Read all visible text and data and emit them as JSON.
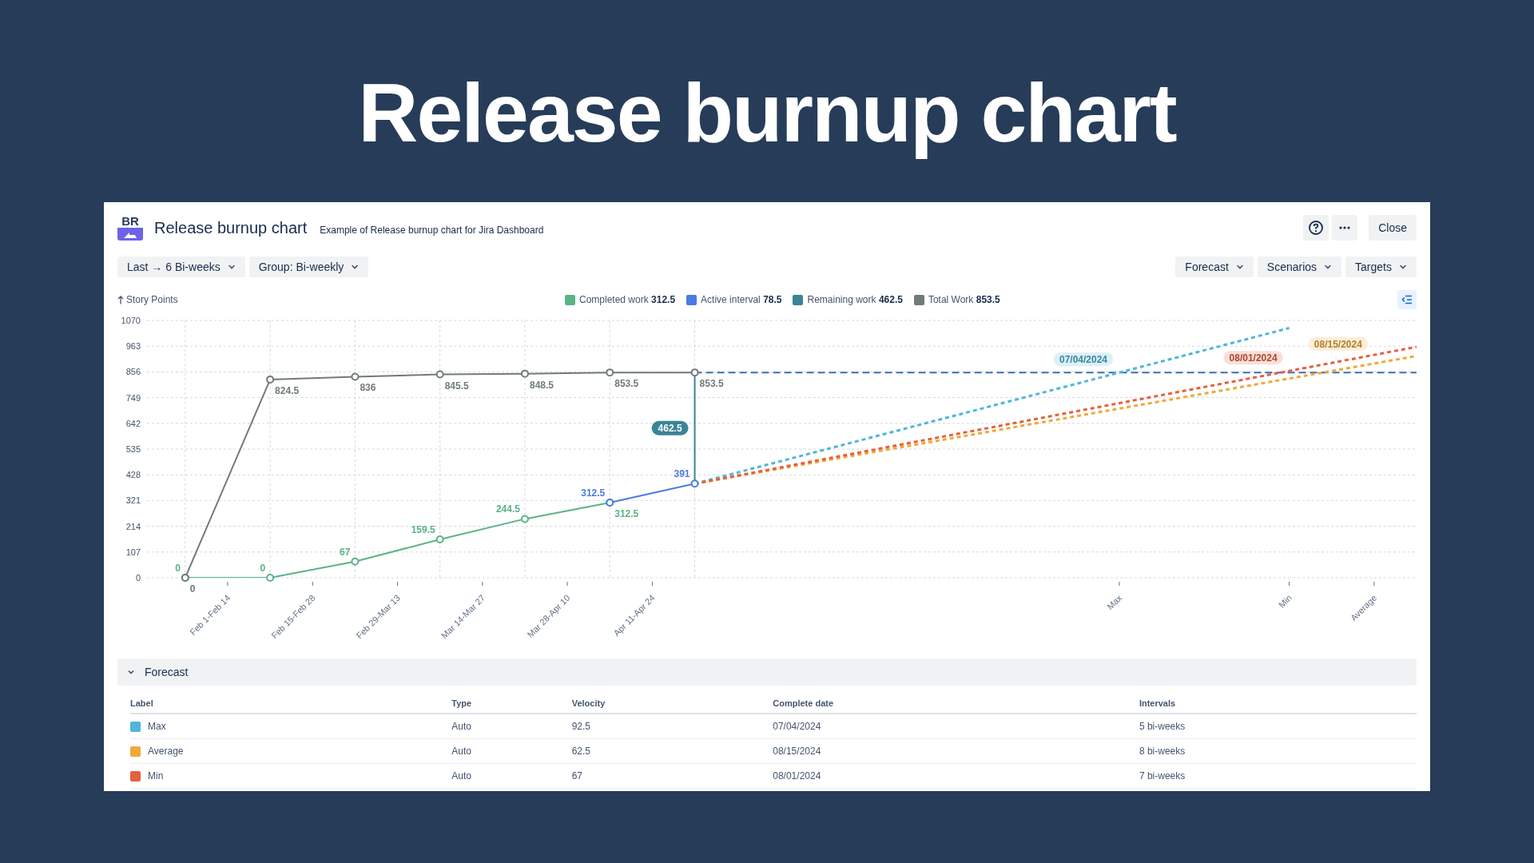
{
  "page_title": "Release burnup chart",
  "panel": {
    "logo": "BR",
    "title": "Release burnup chart",
    "subtitle": "Example of Release burnup chart for Jira Dashboard",
    "close": "Close"
  },
  "filters_left": [
    {
      "label": "Last → 6 Bi-weeks"
    },
    {
      "label": "Group: Bi-weekly"
    }
  ],
  "filters_right": [
    {
      "label": "Forecast"
    },
    {
      "label": "Scenarios"
    },
    {
      "label": "Targets"
    }
  ],
  "chart": {
    "legend": [
      {
        "value": "312.5"
      },
      {
        "value": "78.5"
      },
      {
        "label": "Remaining work",
        "value": "462.5",
        "color": "#3a8496"
      },
      {
        "value": "853.5"
      }
    ],
    "remaining_badge": "462.5",
    "chart_data": {
      "type": "line",
      "ylabel": "Story Points",
      "grid": true,
      "categories": [
        null,
        "Feb 1-Feb 14",
        null,
        "Feb 15-Feb 28",
        null,
        "Feb 29-Mar 13",
        null,
        "Mar 14-Mar 27",
        null,
        "Mar 28-Apr 10",
        null,
        "Apr 11-Apr 24",
        null,
        null,
        null,
        null,
        null,
        null,
        null,
        null,
        null,
        null,
        "Max",
        null,
        null,
        null,
        "Min",
        null,
        "Average",
        null
      ],
      "ylim": [
        0,
        1070
      ],
      "yticks": [
        0,
        107,
        214,
        321,
        428,
        535,
        642,
        749,
        856,
        963,
        1070
      ],
      "series": [
        {
          "name": "Completed work",
          "color": "#5bb386",
          "marker": "circle",
          "values": [
            0,
            null,
            0,
            null,
            67,
            null,
            159.5,
            null,
            244.5,
            null,
            312.5,
            null,
            null,
            null,
            null,
            null,
            null,
            null,
            null,
            null,
            null,
            null,
            null,
            null,
            null,
            null,
            null,
            null,
            null,
            null
          ],
          "value_labels": [
            "0",
            null,
            "0",
            null,
            "67",
            null,
            "159.5",
            null,
            "244.5",
            null,
            "312.5",
            null,
            null,
            null,
            null,
            null,
            null,
            null,
            null,
            null,
            null,
            null,
            null,
            null,
            null,
            null,
            null,
            null,
            null,
            null
          ]
        },
        {
          "name": "Active interval",
          "color": "#4a7be0",
          "marker": "circle",
          "values": [
            null,
            null,
            null,
            null,
            null,
            null,
            null,
            null,
            null,
            null,
            312.5,
            null,
            391,
            null,
            null,
            null,
            null,
            null,
            null,
            null,
            null,
            null,
            null,
            null,
            null,
            null,
            null,
            null,
            null,
            null
          ],
          "value_labels": [
            null,
            null,
            null,
            null,
            null,
            null,
            null,
            null,
            null,
            null,
            "312.5",
            null,
            "391",
            null,
            null,
            null,
            null,
            null,
            null,
            null,
            null,
            null,
            null,
            null,
            null,
            null,
            null,
            null,
            null,
            null
          ]
        },
        {
          "name": "Total Work",
          "color": "#707b7a",
          "marker": "circle",
          "values": [
            0,
            null,
            824.5,
            null,
            836,
            null,
            845.5,
            null,
            848.5,
            null,
            853.5,
            null,
            853.5,
            null,
            null,
            null,
            null,
            null,
            null,
            null,
            null,
            null,
            null,
            null,
            null,
            null,
            null,
            null,
            null,
            null
          ],
          "value_labels": [
            "0",
            null,
            "824.5",
            null,
            "836",
            null,
            "845.5",
            null,
            "848.5",
            null,
            "853.5",
            null,
            "853.5",
            null,
            null,
            null,
            null,
            null,
            null,
            null,
            null,
            null,
            null,
            null,
            null,
            null,
            null,
            null,
            null,
            null
          ]
        },
        {
          "color": "#4fb6d8",
          "line_style": "dashed",
          "values": [
            null,
            null,
            null,
            null,
            null,
            null,
            null,
            null,
            null,
            null,
            null,
            null,
            391,
            null,
            null,
            null,
            null,
            null,
            null,
            null,
            null,
            null,
            853.5,
            null,
            null,
            null,
            1038.5,
            null,
            null,
            null
          ]
        },
        {
          "color": "#f0a93a",
          "line_style": "dashed",
          "values": [
            null,
            null,
            null,
            null,
            null,
            null,
            null,
            null,
            null,
            null,
            null,
            null,
            391,
            null,
            null,
            null,
            null,
            null,
            null,
            null,
            null,
            null,
            null,
            null,
            null,
            null,
            null,
            null,
            891,
            922
          ]
        },
        {
          "color": "#e5603f",
          "line_style": "dashed",
          "values": [
            null,
            null,
            null,
            null,
            null,
            null,
            null,
            null,
            null,
            null,
            null,
            null,
            391,
            null,
            null,
            null,
            null,
            null,
            null,
            null,
            null,
            null,
            null,
            null,
            null,
            null,
            860,
            null,
            null,
            960
          ]
        }
      ],
      "annotations": [
        {
          "x": "Max",
          "y": 853.5,
          "text": "07/04/2024"
        },
        {
          "x": "Min",
          "y": 860,
          "text": "08/01/2024"
        },
        {
          "x": "Average",
          "y": 891,
          "text": "08/15/2024"
        }
      ]
    }
  },
  "forecast": {
    "title": "Forecast",
    "expanded": true,
    "columns": [
      "Label",
      "Type",
      "Velocity",
      "Complete date",
      "Intervals"
    ],
    "rows": [
      {
        "label": "Max",
        "color": "#4fb6d8",
        "type": "Auto",
        "velocity": "92.5",
        "complete_date": "07/04/2024",
        "intervals": "5 bi-weeks"
      },
      {
        "label": "Average",
        "color": "#f0a93a",
        "type": "Auto",
        "velocity": "62.5",
        "complete_date": "08/15/2024",
        "intervals": "8 bi-weeks"
      },
      {
        "label": "Min",
        "color": "#e5603f",
        "type": "Auto",
        "velocity": "67",
        "complete_date": "08/01/2024",
        "intervals": "7 bi-weeks"
      }
    ]
  }
}
